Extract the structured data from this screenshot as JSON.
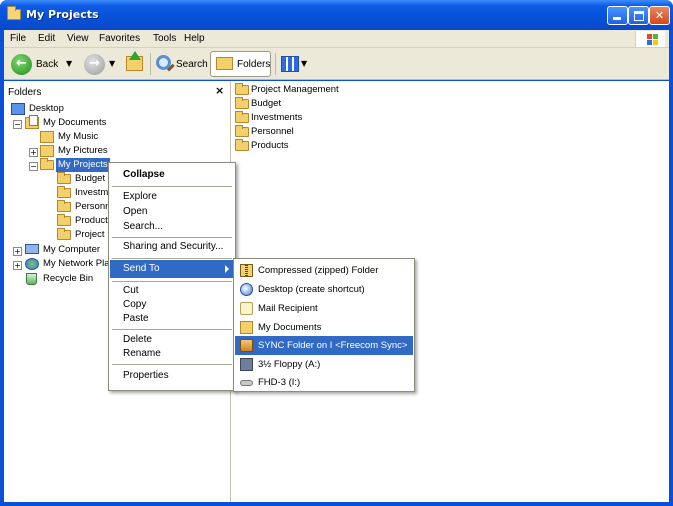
{
  "window": {
    "title": "My Projects"
  },
  "menubar": {
    "items": [
      "File",
      "Edit",
      "View",
      "Favorites",
      "Tools",
      "Help"
    ]
  },
  "toolbar": {
    "back_label": "Back",
    "search_label": "Search",
    "folders_label": "Folders"
  },
  "folders_pane": {
    "title": "Folders",
    "close_glyph": "×",
    "tree": [
      {
        "label": "Desktop",
        "icon": "desktop-icon"
      },
      {
        "label": "My Documents",
        "icon": "my-documents-icon",
        "expander": "⊟"
      },
      {
        "label": "My Music",
        "icon": "my-music-icon"
      },
      {
        "label": "My Pictures",
        "icon": "my-pictures-icon",
        "expander": "⊞"
      },
      {
        "label": "My Projects",
        "icon": "folder-icon",
        "expander": "⊟",
        "selected": true
      },
      {
        "label": "Budget",
        "icon": "folder-icon"
      },
      {
        "label": "Investm",
        "icon": "folder-icon"
      },
      {
        "label": "Personn",
        "icon": "folder-icon"
      },
      {
        "label": "Products",
        "icon": "folder-icon"
      },
      {
        "label": "Project I",
        "icon": "folder-icon"
      },
      {
        "label": "My Computer",
        "icon": "my-computer-icon",
        "expander": "⊞"
      },
      {
        "label": "My Network Plac",
        "icon": "network-icon",
        "expander": "⊞"
      },
      {
        "label": "Recycle Bin",
        "icon": "recycle-bin-icon"
      }
    ]
  },
  "main_pane": {
    "items": [
      "Project Management",
      "Budget",
      "Investments",
      "Personnel",
      "Products"
    ]
  },
  "context_menu": {
    "items": [
      {
        "label": "Collapse",
        "bold": true
      },
      {
        "label": "Explore"
      },
      {
        "label": "Open"
      },
      {
        "label": "Search..."
      },
      {
        "label": "Sharing and Security..."
      },
      {
        "label": "Send To",
        "highlighted": true,
        "submenu": true
      },
      {
        "label": "Cut"
      },
      {
        "label": "Copy"
      },
      {
        "label": "Paste"
      },
      {
        "label": "Delete"
      },
      {
        "label": "Rename"
      },
      {
        "label": "Properties"
      }
    ]
  },
  "send_to_menu": {
    "items": [
      {
        "label": "Compressed (zipped) Folder",
        "icon": "zip-folder-icon"
      },
      {
        "label": "Desktop (create shortcut)",
        "icon": "desktop-shortcut-icon"
      },
      {
        "label": "Mail Recipient",
        "icon": "mail-icon"
      },
      {
        "label": "My Documents",
        "icon": "my-documents-icon"
      },
      {
        "label": "SYNC Folder on I <Freecom Sync>",
        "icon": "sync-folder-icon",
        "highlighted": true
      },
      {
        "label": "3½ Floppy (A:)",
        "icon": "floppy-icon"
      },
      {
        "label": "FHD-3 (I:)",
        "icon": "drive-icon"
      }
    ]
  },
  "colors": {
    "title_bar": "#0652d8",
    "selection": "#316ac5",
    "chrome": "#ece9d8"
  }
}
